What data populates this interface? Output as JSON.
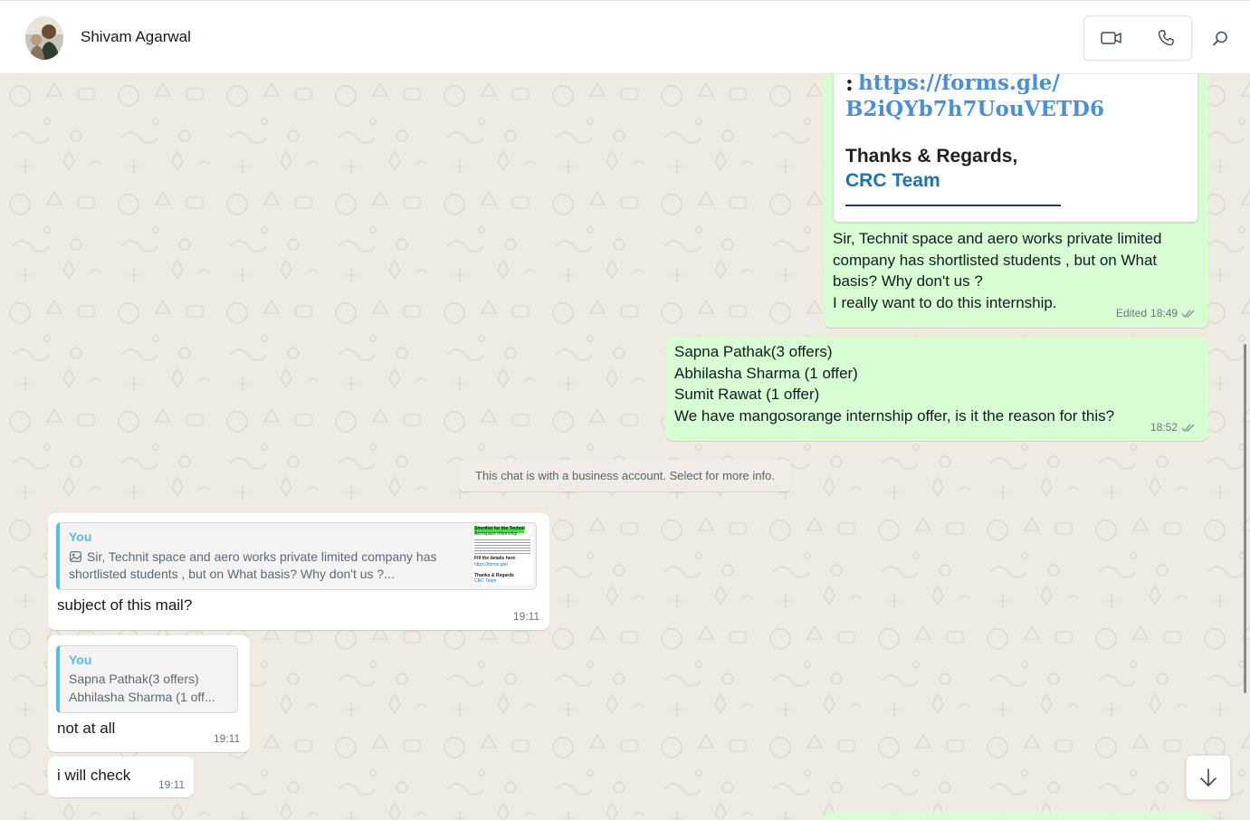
{
  "contact": {
    "name": "Shivam Agarwal"
  },
  "header_actions": {
    "video_icon": "video-camera-icon",
    "voice_icon": "phone-icon",
    "search_icon": "search-icon"
  },
  "messages": [
    {
      "direction": "outgoing",
      "document": {
        "link_prefix": ":",
        "link": "https://forms.gle/ B2iQYb7h7UouVETD6",
        "regards": "Thanks & Regards,",
        "team": "CRC Team"
      },
      "text": "Sir, Technit space and aero works private limited company has shortlisted students , but on What basis? Why don't us ?\nI really want to do this internship.",
      "edited_label": "Edited",
      "time": "18:49",
      "status": "read"
    },
    {
      "direction": "outgoing",
      "text": "Sapna Pathak(3 offers)\nAbhilasha Sharma (1 offer)\nSumit Rawat (1 offer)\nWe have mangosorange internship offer, is it the reason for this?",
      "time": "18:52",
      "status": "read"
    },
    {
      "direction": "incoming",
      "quote": {
        "author": "You",
        "text": "Sir, Technit space and aero works private limited company has shortlisted students , but on What basis? Why don't us ?...",
        "thumb_lines": [
          "Shortlist for the Technit",
          "Aerospace Internship",
          "Fill the details here",
          "https://forms.gle/",
          "Thanks & Regards",
          "CRC Team"
        ]
      },
      "text": "subject of this mail?",
      "time": "19:11"
    },
    {
      "direction": "incoming",
      "quote": {
        "author": "You",
        "text": "Sapna Pathak(3 offers)\nAbhilasha Sharma (1 off..."
      },
      "text": "not at all",
      "time": "19:11"
    },
    {
      "direction": "incoming",
      "text": "i will check",
      "time": "19:11"
    }
  ],
  "system_notice": "This chat is with a business account. Select for more info.",
  "colors": {
    "outgoing_bubble": "#d9fdd3",
    "incoming_bubble": "#ffffff",
    "chat_bg": "#efeae2",
    "quote_accent": "#53bdeb",
    "read_ticks": "#8696a0"
  },
  "icons": {
    "scroll_down": "arrow-down-icon",
    "media": "image-icon"
  }
}
